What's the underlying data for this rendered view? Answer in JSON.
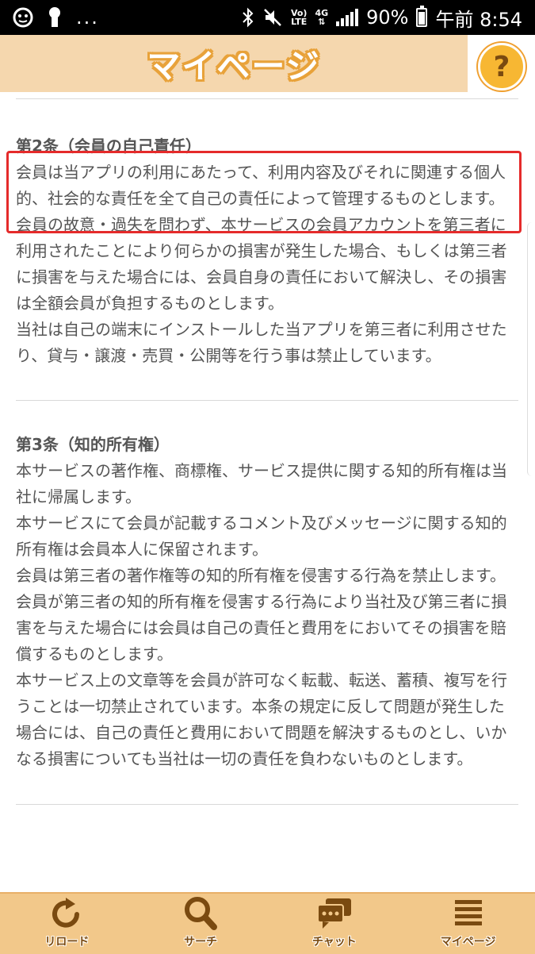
{
  "status_bar": {
    "network_small_top": "Vo)",
    "network_small_bottom": "LTE",
    "signal_type": "4G",
    "battery": "90%",
    "time": "午前 8:54",
    "dots": "..."
  },
  "header": {
    "title": "マイページ",
    "help_label": "?"
  },
  "articles": [
    {
      "title": "第2条（会員の自己責任）",
      "paragraphs": [
        "会員は当アプリの利用にあたって、利用内容及びそれに関連する個人的、社会的な責任を全て自己の責任によって管理するものとします。",
        "会員の故意・過失を問わず、本サービスの会員アカウントを第三者に利用されたことにより何らかの損害が発生した場合、もしくは第三者に損害を与えた場合には、会員自身の責任において解決し、その損害は全額会員が負担するものとします。",
        "当社は自己の端末にインストールした当アプリを第三者に利用させたり、貸与・譲渡・売買・公開等を行う事は禁止しています。"
      ]
    },
    {
      "title": "第3条（知的所有権）",
      "paragraphs": [
        "本サービスの著作権、商標権、サービス提供に関する知的所有権は当社に帰属します。",
        "本サービスにて会員が記載するコメント及びメッセージに関する知的所有権は会員本人に保留されます。",
        "会員は第三者の著作権等の知的所有権を侵害する行為を禁止します。",
        "会員が第三者の知的所有権を侵害する行為により当社及び第三者に損害を与えた場合には会員は自己の責任と費用をにおいてその損害を賠償するものとします。",
        "本サービス上の文章等を会員が許可なく転載、転送、蓄積、複写を行うことは一切禁止されています。本条の規定に反して問題が発生した場合には、自己の責任と費用において問題を解決するものとし、いかなる損害についても当社は一切の責任を負わないものとします。"
      ]
    }
  ],
  "bottom_nav": [
    {
      "label": "リロード",
      "icon": "reload-icon"
    },
    {
      "label": "サーチ",
      "icon": "search-icon"
    },
    {
      "label": "チャット",
      "icon": "chat-icon"
    },
    {
      "label": "マイページ",
      "icon": "menu-list-icon"
    }
  ],
  "colors": {
    "header_bg": "#f5d7ae",
    "title_outline": "#e8a23a",
    "highlight_border": "#e52b2b",
    "nav_bg": "#f2c88a",
    "nav_icon": "#7a4a10"
  }
}
